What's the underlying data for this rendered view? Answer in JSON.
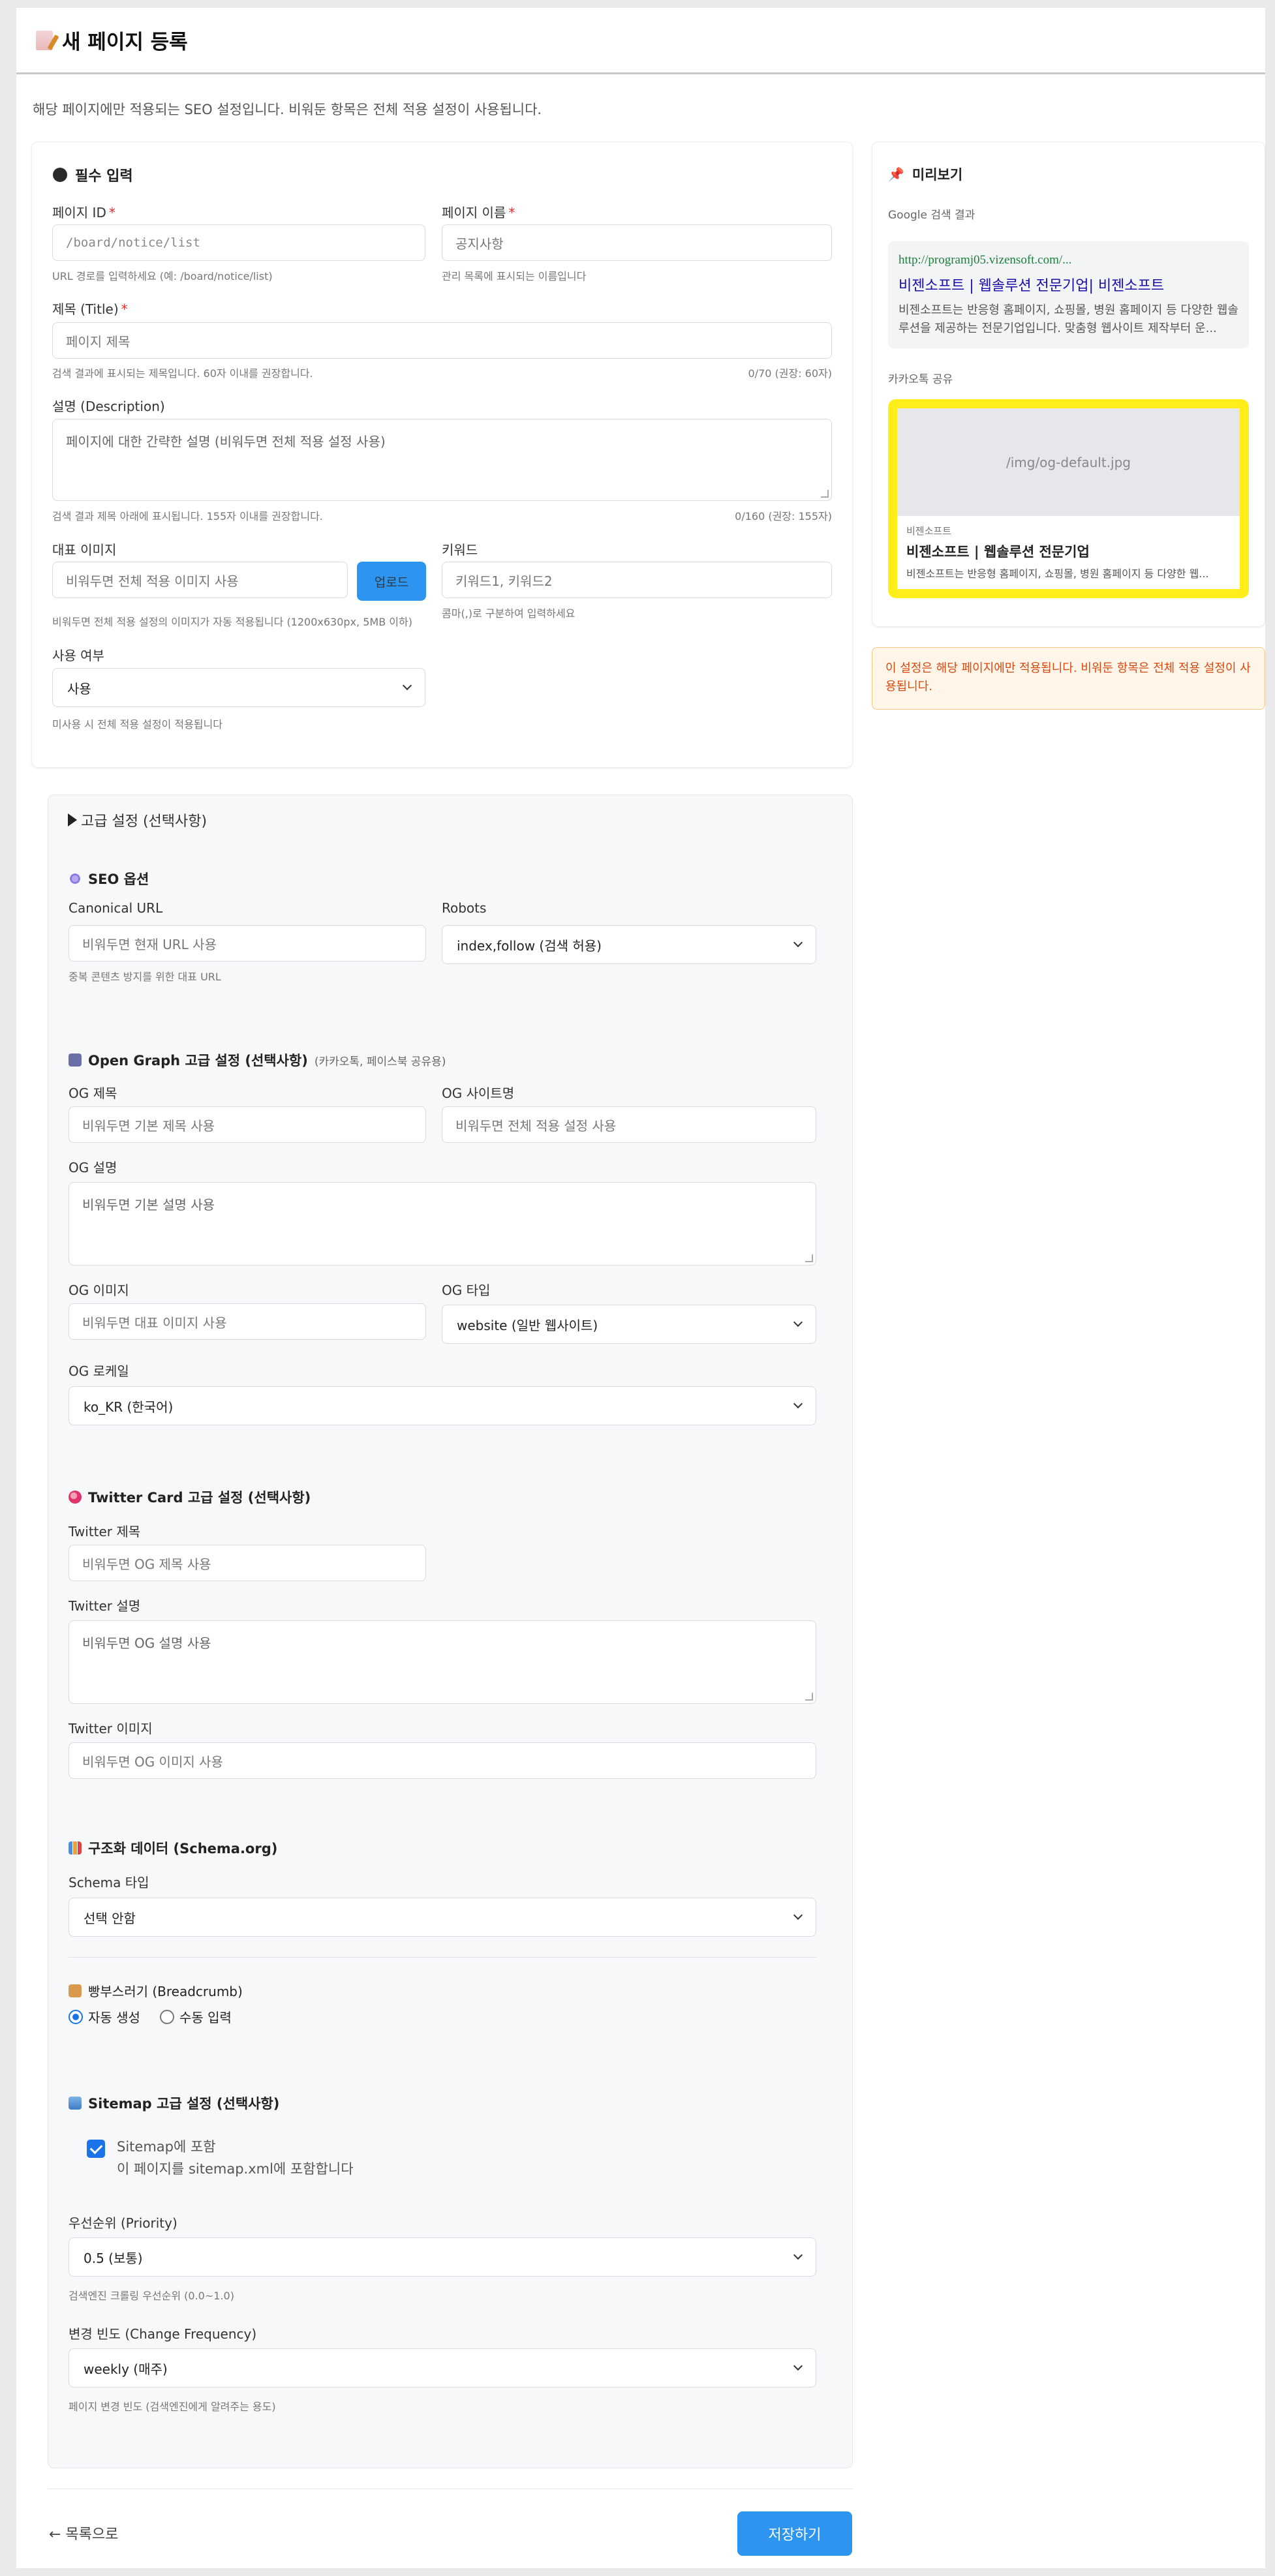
{
  "header": {
    "title": "새 페이지 등록",
    "icon": "memo-icon"
  },
  "intro": "해당 페이지에만 적용되는 SEO 설정입니다. 비워둔 항목은 전체 적용 설정이 사용됩니다.",
  "required": {
    "title": "필수 입력",
    "page_id": {
      "label": "페이지 ID",
      "placeholder": "/board/notice/list",
      "help": "URL 경로를 입력하세요 (예: /board/notice/list)"
    },
    "page_name": {
      "label": "페이지 이름",
      "placeholder": "공지사항",
      "help": "관리 목록에 표시되는 이름입니다"
    },
    "seo_title": {
      "label": "제목 (Title)",
      "placeholder": "페이지 제목",
      "help": "검색 결과에 표시되는 제목입니다. 60자 이내를 권장합니다.",
      "count": "0/70 (권장: 60자)"
    },
    "description": {
      "label": "설명 (Description)",
      "placeholder": "페이지에 대한 간략한 설명 (비워두면 전체 적용 설정 사용)",
      "help": "검색 결과 제목 아래에 표시됩니다. 155자 이내를 권장합니다.",
      "count": "0/160 (권장: 155자)"
    },
    "image": {
      "label": "대표 이미지",
      "placeholder": "비워두면 전체 적용 이미지 사용",
      "upload": "업로드",
      "help": "비워두면 전체 적용 설정의 이미지가 자동 적용됩니다 (1200x630px, 5MB 이하)"
    },
    "keywords": {
      "label": "키워드",
      "placeholder": "키워드1, 키워드2",
      "help": "콤마(,)로 구분하여 입력하세요"
    },
    "use": {
      "label": "사용 여부",
      "value": "사용",
      "help": "미사용 시 전체 적용 설정이 적용됩니다"
    }
  },
  "advanced": {
    "summary": "고급 설정 (선택사항)",
    "seo": {
      "title": "SEO 옵션",
      "canonical": {
        "label": "Canonical URL",
        "placeholder": "비워두면 현재 URL 사용",
        "help": "중복 콘텐츠 방지를 위한 대표 URL"
      },
      "robots": {
        "label": "Robots",
        "value": "index,follow (검색 허용)"
      }
    },
    "og": {
      "title": "Open Graph 고급 설정 (선택사항)",
      "note": "(카카오톡, 페이스북 공유용)",
      "og_title": {
        "label": "OG 제목",
        "placeholder": "비워두면 기본 제목 사용"
      },
      "og_site": {
        "label": "OG 사이트명",
        "placeholder": "비워두면 전체 적용 설정 사용"
      },
      "og_desc": {
        "label": "OG 설명",
        "placeholder": "비워두면 기본 설명 사용"
      },
      "og_image": {
        "label": "OG 이미지",
        "placeholder": "비워두면 대표 이미지 사용"
      },
      "og_type": {
        "label": "OG 타입",
        "value": "website (일반 웹사이트)"
      },
      "og_locale": {
        "label": "OG 로케일",
        "value": "ko_KR (한국어)"
      }
    },
    "twitter": {
      "title": "Twitter Card 고급 설정 (선택사항)",
      "tw_title": {
        "label": "Twitter 제목",
        "placeholder": "비워두면 OG 제목 사용"
      },
      "tw_desc": {
        "label": "Twitter 설명",
        "placeholder": "비워두면 OG 설명 사용"
      },
      "tw_image": {
        "label": "Twitter 이미지",
        "placeholder": "비워두면 OG 이미지 사용"
      }
    },
    "schema": {
      "title": "구조화 데이터 (Schema.org)",
      "type": {
        "label": "Schema 타입",
        "value": "선택 안함"
      },
      "breadcrumb": {
        "title": "빵부스러기 (Breadcrumb)",
        "auto": "자동 생성",
        "manual": "수동 입력",
        "selected": "auto"
      }
    },
    "sitemap": {
      "title": "Sitemap 고급 설정 (선택사항)",
      "include": {
        "label": "Sitemap에 포함",
        "sub": "이 페이지를 sitemap.xml에 포함합니다",
        "checked": true
      },
      "priority": {
        "label": "우선순위 (Priority)",
        "value": "0.5 (보통)",
        "help": "검색엔진 크롤링 우선순위 (0.0~1.0)"
      },
      "changefreq": {
        "label": "변경 빈도 (Change Frequency)",
        "value": "weekly (매주)",
        "help": "페이지 변경 빈도 (검색엔진에게 알려주는 용도)"
      }
    }
  },
  "footer": {
    "back": "← 목록으로",
    "save": "저장하기"
  },
  "preview": {
    "title": "미리보기",
    "google_label": "Google 검색 결과",
    "google": {
      "url": "http://programj05.vizensoft.com/...",
      "title": "비젠소프트 | 웹솔루션 전문기업| 비젠소프트",
      "desc": "비젠소프트는 반응형 홈페이지, 쇼핑몰, 병원 홈페이지 등 다양한 웹솔루션을 제공하는 전문기업입니다. 맞춤형 웹사이트 제작부터 운..."
    },
    "kakao_label": "카카오톡 공유",
    "kakao": {
      "image": "/img/og-default.jpg",
      "site": "비젠소프트",
      "title": "비젠소프트 | 웹솔루션 전문기업",
      "desc": "비젠소프트는 반응형 홈페이지, 쇼핑몰, 병원 홈페이지 등 다양한 웹..."
    },
    "warning": "이 설정은 해당 페이지에만 적용됩니다. 비워둔 항목은 전체 적용 설정이 사용됩니다."
  },
  "colors": {
    "primary": "#2d95f0",
    "required": "#e03131",
    "kakao_border": "#ffee1a",
    "warn_text": "#d9480f"
  }
}
